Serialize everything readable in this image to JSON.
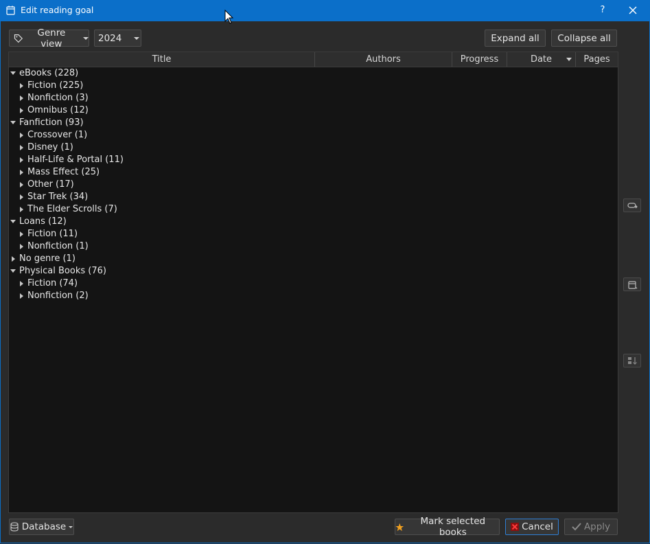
{
  "window": {
    "title": "Edit reading goal",
    "help_label": "?",
    "close_icon": "close-icon"
  },
  "toolbar": {
    "view_label": "Genre view",
    "year_value": "2024",
    "expand_all": "Expand all",
    "collapse_all": "Collapse all"
  },
  "columns": [
    "Title",
    "Authors",
    "Progress",
    "Date",
    "Pages"
  ],
  "tree": [
    {
      "label": "eBooks (228)",
      "level": 0,
      "expanded": true
    },
    {
      "label": "Fiction (225)",
      "level": 1,
      "expanded": false
    },
    {
      "label": "Nonfiction (3)",
      "level": 1,
      "expanded": false
    },
    {
      "label": "Omnibus (12)",
      "level": 1,
      "expanded": false
    },
    {
      "label": "Fanfiction (93)",
      "level": 0,
      "expanded": true
    },
    {
      "label": "Crossover (1)",
      "level": 1,
      "expanded": false
    },
    {
      "label": "Disney (1)",
      "level": 1,
      "expanded": false
    },
    {
      "label": "Half-Life & Portal (11)",
      "level": 1,
      "expanded": false
    },
    {
      "label": "Mass Effect (25)",
      "level": 1,
      "expanded": false
    },
    {
      "label": "Other (17)",
      "level": 1,
      "expanded": false
    },
    {
      "label": "Star Trek (34)",
      "level": 1,
      "expanded": false
    },
    {
      "label": "The Elder Scrolls (7)",
      "level": 1,
      "expanded": false
    },
    {
      "label": "Loans (12)",
      "level": 0,
      "expanded": true
    },
    {
      "label": "Fiction (11)",
      "level": 1,
      "expanded": false
    },
    {
      "label": "Nonfiction (1)",
      "level": 1,
      "expanded": false
    },
    {
      "label": "No genre (1)",
      "level": 0,
      "expanded": false
    },
    {
      "label": "Physical Books (76)",
      "level": 0,
      "expanded": true
    },
    {
      "label": "Fiction (74)",
      "level": 1,
      "expanded": false
    },
    {
      "label": "Nonfiction (2)",
      "level": 1,
      "expanded": false
    }
  ],
  "footer": {
    "database_label": "Database",
    "mark_label": "Mark selected books",
    "cancel_label": "Cancel",
    "apply_label": "Apply"
  },
  "colors": {
    "titlebar": "#0b6fc9",
    "background": "#2b2b2b",
    "tree_bg": "#141414",
    "star": "#f0a020",
    "cancel_x": "#d02020"
  }
}
